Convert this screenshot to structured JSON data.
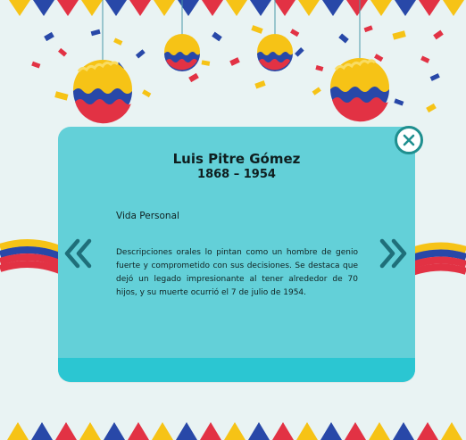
{
  "biography": {
    "name": "Luis Pitre Gómez",
    "dates": "1868 – 1954",
    "section_title": "Vida Personal",
    "description": "Descripciones orales lo pintan como un hombre de genio fuerte y comprometido con sus decisiones. Se destaca que dejó un legado impresionante al tener alrededor de 70 hijos, y su muerte ocurrió el 7 de julio de 1954."
  },
  "controls": {
    "close_icon": "close-x-icon",
    "prev_icon": "double-chevron-left-icon",
    "next_icon": "double-chevron-right-icon"
  },
  "theme": {
    "background": "#e9f3f3",
    "card": "#63d0d8",
    "card_footer": "#2bc6d2",
    "accent_teal": "#1f8f8f",
    "flag_yellow": "#f6c316",
    "flag_blue": "#2848a8",
    "flag_red": "#e23244"
  }
}
